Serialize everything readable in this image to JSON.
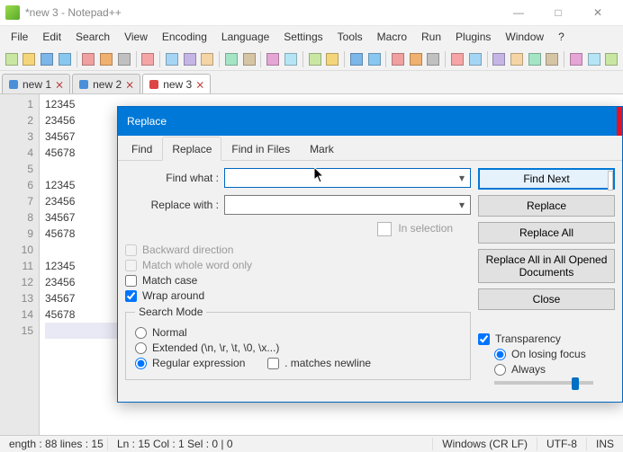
{
  "window": {
    "title": "*new 3 - Notepad++"
  },
  "menubar": [
    "File",
    "Edit",
    "Search",
    "View",
    "Encoding",
    "Language",
    "Settings",
    "Tools",
    "Macro",
    "Run",
    "Plugins",
    "Window",
    "?"
  ],
  "toolbar_icons": [
    "new-file",
    "open-file",
    "save",
    "save-all",
    "close",
    "close-all",
    "print",
    "cut",
    "copy",
    "paste",
    "undo",
    "redo",
    "find",
    "replace",
    "zoom-in",
    "zoom-out",
    "sync-v",
    "sync-h",
    "word-wrap",
    "show-all",
    "indent-guide",
    "udldef",
    "doc-map",
    "doc-list",
    "func-list",
    "folder-workspace",
    "monitor",
    "record",
    "stop-record",
    "play",
    "run-multiple"
  ],
  "doc_tabs": [
    {
      "label": "new 1",
      "dirty": false,
      "active": false
    },
    {
      "label": "new 2",
      "dirty": false,
      "active": false
    },
    {
      "label": "new 3",
      "dirty": true,
      "active": true
    }
  ],
  "editor": {
    "gutter": [
      "1",
      "2",
      "3",
      "4",
      "5",
      "6",
      "7",
      "8",
      "9",
      "10",
      "11",
      "12",
      "13",
      "14",
      "15"
    ],
    "lines": [
      "12345",
      "23456",
      "34567",
      "45678",
      "",
      "12345",
      "23456",
      "34567",
      "45678",
      "",
      "12345",
      "23456",
      "34567",
      "45678",
      ""
    ],
    "cursor_line": 15
  },
  "dialog": {
    "title": "Replace",
    "tabs": [
      "Find",
      "Replace",
      "Find in Files",
      "Mark"
    ],
    "active_tab": "Replace",
    "find_label": "Find what :",
    "find_value": "",
    "replace_label": "Replace with :",
    "replace_value": "",
    "in_selection": "In selection",
    "backward": "Backward direction",
    "whole_word": "Match whole word only",
    "match_case": "Match case",
    "wrap": "Wrap around",
    "search_mode_legend": "Search Mode",
    "sm_normal": "Normal",
    "sm_extended": "Extended (\\n, \\r, \\t, \\0, \\x...)",
    "sm_regex": "Regular expression",
    "sm_dotnl": ". matches newline",
    "transparency_legend": "Transparency",
    "tr_onlose": "On losing focus",
    "tr_always": "Always",
    "btn_find_next": "Find Next",
    "btn_replace": "Replace",
    "btn_replace_all": "Replace All",
    "btn_replace_all_docs": "Replace All in All Opened Documents",
    "btn_close": "Close"
  },
  "status": {
    "length_lines": "ength : 88    lines : 15",
    "pos": "Ln : 15    Col : 1    Sel : 0 | 0",
    "eol": "Windows (CR LF)",
    "enc": "UTF-8",
    "mode": "INS"
  }
}
